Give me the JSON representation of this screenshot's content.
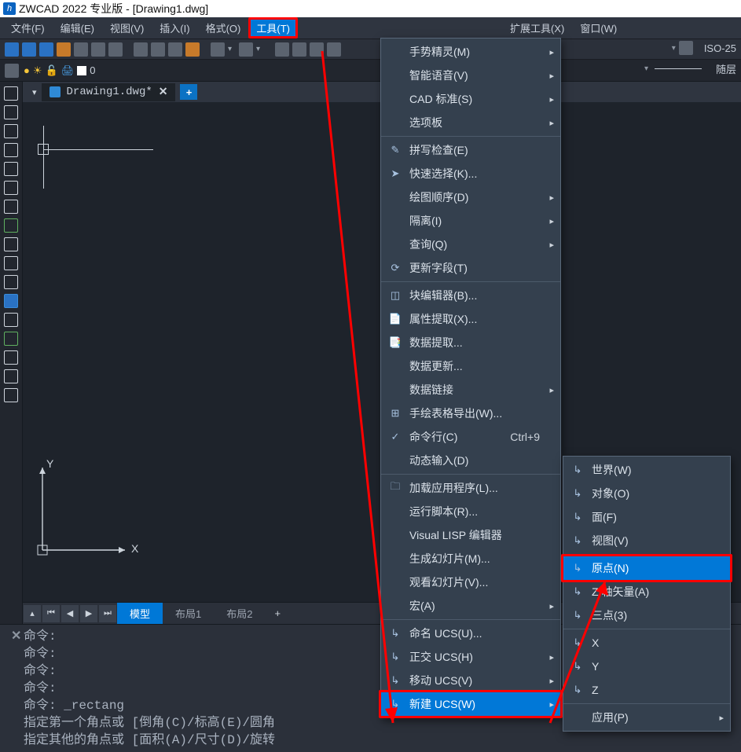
{
  "title": "ZWCAD 2022 专业版 - [Drawing1.dwg]",
  "menubar": {
    "file": "文件(F)",
    "edit": "编辑(E)",
    "view": "视图(V)",
    "insert": "插入(I)",
    "format": "格式(O)",
    "tools": "工具(T)",
    "extend": "扩展工具(X)",
    "window": "窗口(W)"
  },
  "propbar": {
    "layer0": "0",
    "iso": "ISO-25",
    "bylayer": "随层"
  },
  "doc_tab": {
    "name": "Drawing1.dwg*"
  },
  "sheets": {
    "model": "模型",
    "layout1": "布局1",
    "layout2": "布局2"
  },
  "ucs_labels": {
    "x": "X",
    "y": "Y"
  },
  "cmd": {
    "l1": "命令:",
    "l2": "命令:",
    "l3": "命令:",
    "l4": "命令:",
    "l5": "命令: _rectang",
    "l6": "指定第一个角点或 [倒角(C)/标高(E)/圆角",
    "l7": "指定其他的角点或 [面积(A)/尺寸(D)/旋转"
  },
  "tools_menu": {
    "gesture": "手势精灵(M)",
    "voice": "智能语音(V)",
    "cadstd": "CAD 标准(S)",
    "palettes": "选项板",
    "spell": "拼写检查(E)",
    "qselect": "快速选择(K)...",
    "draworder": "绘图顺序(D)",
    "isolate": "隔离(I)",
    "inquiry": "查询(Q)",
    "updatefield": "更新字段(T)",
    "blockedit": "块编辑器(B)...",
    "attrext": "属性提取(X)...",
    "dataext": "数据提取...",
    "dataupd": "数据更新...",
    "datalink": "数据链接",
    "tableexport": "手绘表格导出(W)...",
    "cmdline": "命令行(C)",
    "cmdline_shortcut": "Ctrl+9",
    "dyninput": "动态输入(D)",
    "loadapp": "加载应用程序(L)...",
    "runscript": "运行脚本(R)...",
    "vlisp": "Visual LISP 编辑器",
    "mkslide": "生成幻灯片(M)...",
    "viewslide": "观看幻灯片(V)...",
    "macro": "宏(A)",
    "namedUCS": "命名 UCS(U)...",
    "orthoUCS": "正交 UCS(H)",
    "moveUCS": "移动 UCS(V)",
    "newUCS": "新建 UCS(W)"
  },
  "ucs_submenu": {
    "world": "世界(W)",
    "object": "对象(O)",
    "face": "面(F)",
    "view": "视图(V)",
    "origin": "原点(N)",
    "zaxis": "Z 轴矢量(A)",
    "three": "三点(3)",
    "x": "X",
    "y": "Y",
    "z": "Z",
    "apply": "应用(P)"
  }
}
